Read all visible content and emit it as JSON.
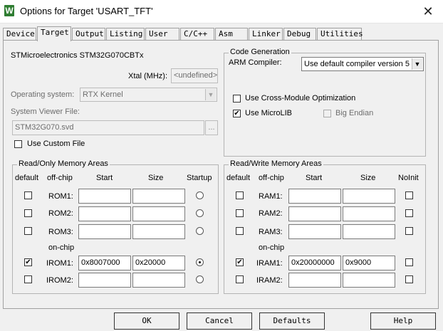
{
  "window": {
    "title": "Options for Target 'USART_TFT'",
    "icon_letter": "W",
    "close_glyph": "✕"
  },
  "tabs": [
    "Device",
    "Target",
    "Output",
    "Listing",
    "User",
    "C/C++",
    "Asm",
    "Linker",
    "Debug",
    "Utilities"
  ],
  "active_tab": "Target",
  "target": {
    "device_name": "STMicroelectronics STM32G070CBTx",
    "xtal_label": "Xtal (MHz):",
    "xtal_value": "<undefined>",
    "os_label": "Operating system:",
    "os_value": "RTX Kernel",
    "svd_label": "System Viewer File:",
    "svd_value": "STM32G070.svd",
    "browse_label": "...",
    "custom_file_label": "Use Custom File",
    "custom_file_checked": false
  },
  "codegen": {
    "group_title": "Code Generation",
    "compiler_label": "ARM Compiler:",
    "compiler_value": "Use default compiler version 5",
    "cross_module_label": "Use Cross-Module Optimization",
    "cross_module_checked": false,
    "microlib_label": "Use MicroLIB",
    "microlib_checked": true,
    "big_endian_label": "Big Endian",
    "big_endian_checked": false
  },
  "ro_memory": {
    "group_title": "Read/Only Memory Areas",
    "headers": {
      "default": "default",
      "offchip": "off-chip",
      "start": "Start",
      "size": "Size",
      "extra": "Startup"
    },
    "onchip_label": "on-chip",
    "rows": [
      {
        "label": "ROM1:",
        "default": false,
        "start": "",
        "size": "",
        "selected": false
      },
      {
        "label": "ROM2:",
        "default": false,
        "start": "",
        "size": "",
        "selected": false
      },
      {
        "label": "ROM3:",
        "default": false,
        "start": "",
        "size": "",
        "selected": false
      },
      {
        "label": "IROM1:",
        "default": true,
        "start": "0x8007000",
        "size": "0x20000",
        "selected": true
      },
      {
        "label": "IROM2:",
        "default": false,
        "start": "",
        "size": "",
        "selected": false
      }
    ]
  },
  "rw_memory": {
    "group_title": "Read/Write Memory Areas",
    "headers": {
      "default": "default",
      "offchip": "off-chip",
      "start": "Start",
      "size": "Size",
      "extra": "NoInit"
    },
    "onchip_label": "on-chip",
    "rows": [
      {
        "label": "RAM1:",
        "default": false,
        "start": "",
        "size": "",
        "noinit": false
      },
      {
        "label": "RAM2:",
        "default": false,
        "start": "",
        "size": "",
        "noinit": false
      },
      {
        "label": "RAM3:",
        "default": false,
        "start": "",
        "size": "",
        "noinit": false
      },
      {
        "label": "IRAM1:",
        "default": true,
        "start": "0x20000000",
        "size": "0x9000",
        "noinit": false
      },
      {
        "label": "IRAM2:",
        "default": false,
        "start": "",
        "size": "",
        "noinit": false
      }
    ]
  },
  "buttons": {
    "ok": "OK",
    "cancel": "Cancel",
    "defaults": "Defaults",
    "help": "Help"
  },
  "check_glyph": "✔",
  "dropdown_glyph": "▼",
  "colors": {
    "icon_bg": "#2f7d32",
    "panel_bg": "#f0f0f0"
  }
}
